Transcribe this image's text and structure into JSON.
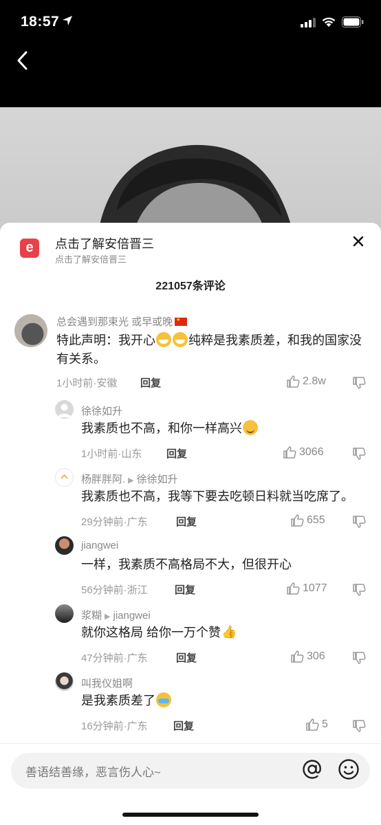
{
  "status": {
    "time": "18:57"
  },
  "sheet": {
    "app_logo": "e",
    "title": "点击了解安倍晋三",
    "subtitle": "点击了解安倍晋三",
    "comment_count": "221057条评论"
  },
  "comments": [
    {
      "user": "总会遇到那束光 或早或晚",
      "text_a": "特此声明：我开心",
      "text_b": "纯粹是我素质差，和我的国家没有关系。",
      "meta": "1小时前·安徽",
      "reply": "回复",
      "likes": "2.8w"
    },
    {
      "user": "徐徐如升",
      "text_a": "我素质也不高，和你一样高兴",
      "meta": "1小时前·山东",
      "reply": "回复",
      "likes": "3066"
    },
    {
      "user": "杨胖胖阿.",
      "reply_to": "徐徐如升",
      "text_a": "我素质也不高，我等下要去吃顿日料就当吃席了。",
      "meta": "29分钟前·广东",
      "reply": "回复",
      "likes": "655"
    },
    {
      "user": "jiangwei",
      "text_a": "一样，我素质不高格局不大，但很开心",
      "meta": "56分钟前·浙江",
      "reply": "回复",
      "likes": "1077"
    },
    {
      "user": "浆糊",
      "reply_to": "jiangwei",
      "text_a": "就你这格局 给你一万个赞",
      "meta": "47分钟前·广东",
      "reply": "回复",
      "likes": "306"
    },
    {
      "user": "叫我仪姐啊",
      "text_a": "是我素质差了",
      "meta": "16分钟前·广东",
      "reply": "回复",
      "likes": "5"
    }
  ],
  "input": {
    "placeholder": "善语结善缘，恶言伤人心~"
  },
  "icons": {
    "back": "chevron-left-icon",
    "close": "close-icon",
    "like": "thumbs-up-icon",
    "dislike": "thumbs-down-icon",
    "at": "at-icon",
    "emoji": "smiley-icon"
  },
  "colors": {
    "brand": "#e8414a",
    "background": "#000000",
    "sheet": "#ffffff"
  }
}
